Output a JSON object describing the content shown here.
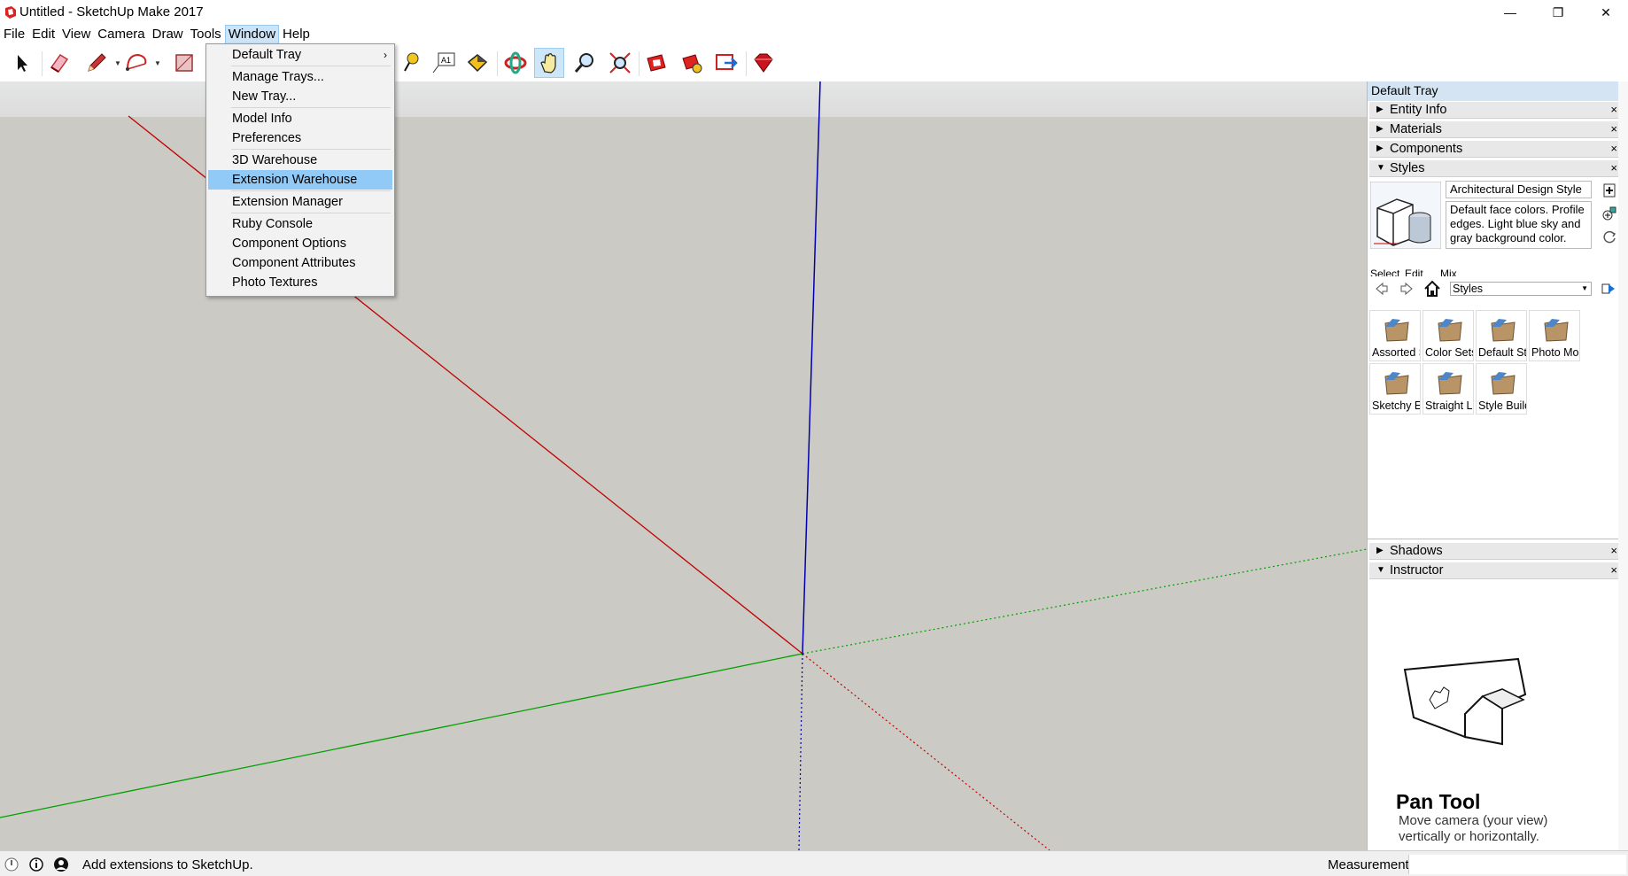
{
  "window": {
    "title": "Untitled - SketchUp Make 2017",
    "minimize": "—",
    "restore": "❐",
    "close": "✕"
  },
  "menubar": {
    "items": [
      "File",
      "Edit",
      "View",
      "Camera",
      "Draw",
      "Tools",
      "Window",
      "Help"
    ],
    "active": "Window"
  },
  "window_menu": {
    "items": [
      {
        "label": "Default Tray",
        "submenu": "›"
      },
      {
        "label": "Manage Trays..."
      },
      {
        "label": "New Tray..."
      },
      {
        "label": "Model Info"
      },
      {
        "label": "Preferences"
      },
      {
        "label": "3D Warehouse"
      },
      {
        "label": "Extension Warehouse"
      },
      {
        "label": "Extension Manager"
      },
      {
        "label": "Ruby Console"
      },
      {
        "label": "Component Options"
      },
      {
        "label": "Component Attributes"
      },
      {
        "label": "Photo Textures"
      }
    ],
    "highlighted": "Extension Warehouse"
  },
  "toolbar": {
    "tools": [
      "select-icon",
      "eraser-icon",
      "pencil-icon",
      "arc-icon",
      "rectangle-icon",
      "push-pull-icon",
      "move-icon",
      "offset-icon",
      "rotate-icon",
      "scale-icon",
      "tape-measure-icon",
      "text-icon",
      "paint-bucket-icon",
      "orbit-icon",
      "pan-icon",
      "zoom-icon",
      "zoom-extents-icon",
      "warehouse-icon",
      "extension-warehouse-icon",
      "share-model-icon",
      "ruby-console-icon"
    ],
    "active_tool": "pan-icon"
  },
  "tray": {
    "title": "Default Tray",
    "panels": {
      "entity_info": "Entity Info",
      "materials": "Materials",
      "components": "Components",
      "styles": "Styles",
      "shadows": "Shadows",
      "instructor": "Instructor"
    },
    "close_glyph": "×",
    "collapsed_glyph": "▶",
    "expanded_glyph": "▼",
    "styles": {
      "name": "Architectural Design Style",
      "description": "Default face colors. Profile edges. Light blue sky and gray background color.",
      "tabs": [
        "Select",
        "Edit",
        "Mix"
      ],
      "collection": "Styles",
      "folders": [
        "Assorted Styles",
        "Color Sets",
        "Default Styles",
        "Photo Modeling",
        "Sketchy Edges",
        "Straight Lines",
        "Style Builder"
      ]
    },
    "instructor": {
      "title": "Pan Tool",
      "line1": "Move camera (your view)",
      "line2": "vertically or horizontally."
    }
  },
  "status": {
    "message": "Add extensions to SketchUp.",
    "measurements_label": "Measurements"
  },
  "colors": {
    "red_axis": "#cc0000",
    "green_axis": "#00a000",
    "blue_axis": "#0000cc",
    "background": "#cbcac4",
    "menu_highlight": "#91c9f7"
  }
}
